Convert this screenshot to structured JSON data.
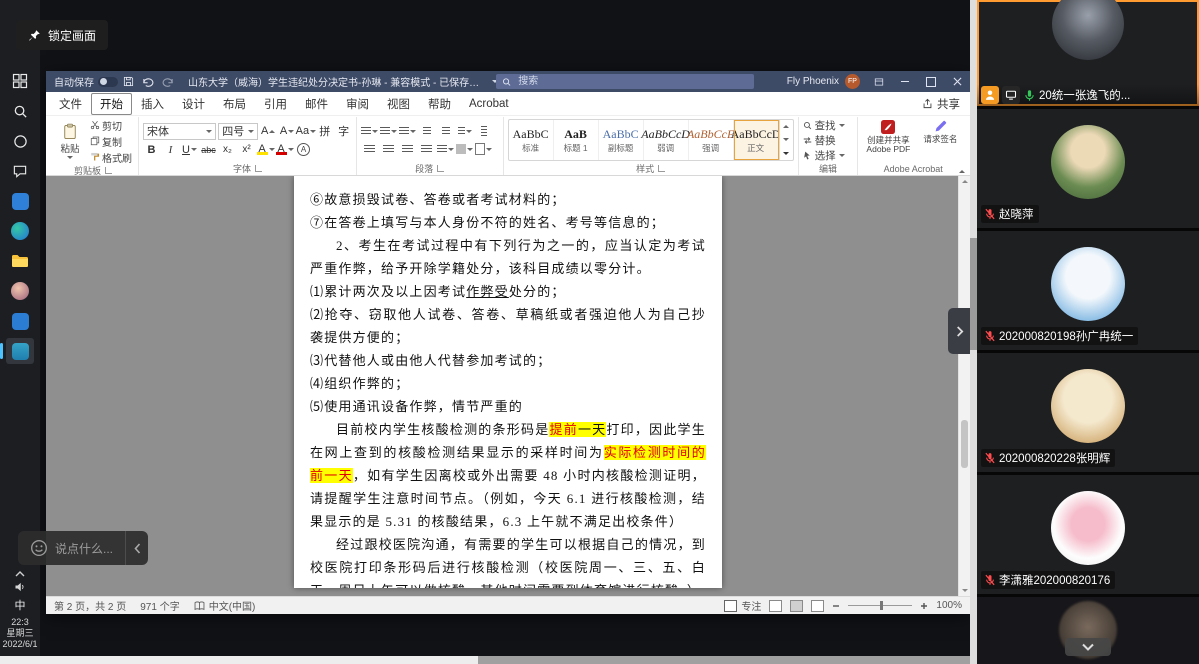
{
  "colors": {
    "highlight_yellow": "#ffff00",
    "warning_text_red": "#e00000",
    "mic_muted_red": "#ff4d4f",
    "mic_on_green": "#34c759",
    "speaking_border_orange": "#ff9b30",
    "word_titlebar_blue": "#3e4b66",
    "taskbar_accent_blue": "#4cc2ff"
  },
  "meeting": {
    "lock_button_label": "锁定画面",
    "chat_placeholder": "说点什么...",
    "participants": [
      {
        "name": "20统一张逸飞的...",
        "mic": "on",
        "role": "presenter"
      },
      {
        "name": "赵晓萍",
        "mic": "muted"
      },
      {
        "name": "202000820198孙广冉统一",
        "mic": "muted"
      },
      {
        "name": "202000820228张明辉",
        "mic": "muted"
      },
      {
        "name": "李潇雅202000820176",
        "mic": "muted"
      }
    ]
  },
  "desktop": {
    "ime_indicator": "中",
    "clock": {
      "time": "22:3",
      "weekday": "星期三",
      "date": "2022/6/1"
    }
  },
  "word": {
    "titlebar": {
      "autosave_label": "自动保存",
      "title": "山东大学（威海）学生违纪处分决定书-孙琳 - 兼容模式 - 已保存到此电脑",
      "search_placeholder": "搜索",
      "user_name": "Fly Phoenix",
      "user_initials": "FP"
    },
    "tabs": [
      "文件",
      "开始",
      "插入",
      "设计",
      "布局",
      "引用",
      "邮件",
      "审阅",
      "视图",
      "帮助",
      "Acrobat"
    ],
    "active_tab": "开始",
    "share_button": "共享",
    "ribbon": {
      "clipboard": {
        "group_label": "剪贴板",
        "paste": "粘贴",
        "cut": "剪切",
        "copy": "复制",
        "format_painter": "格式刷"
      },
      "font": {
        "group_label": "字体",
        "font_name": "宋体",
        "font_size": "四号",
        "grow_font": "A",
        "shrink_font": "A",
        "change_case": "Aa",
        "phonetic": "拼",
        "char_border": "字",
        "bold": "B",
        "italic": "I",
        "underline": "U",
        "strikethrough": "abc",
        "subscript": "x₂",
        "superscript": "x²",
        "text_highlight": "A",
        "font_color": "A",
        "enclose": "A"
      },
      "paragraph": {
        "group_label": "段落"
      },
      "styles": {
        "group_label": "样式",
        "items": [
          {
            "preview": "AaBbC",
            "name": "标准"
          },
          {
            "preview": "AaB",
            "name": "标题 1"
          },
          {
            "preview": "AaBbC",
            "name": "副标题"
          },
          {
            "preview": "AaBbCcD",
            "name": "弱调"
          },
          {
            "preview": "AaBbCcE",
            "name": "强调"
          },
          {
            "preview": "AaBbCcD",
            "name": "正文"
          }
        ]
      },
      "editing": {
        "group_label": "编辑",
        "find": "查找",
        "replace": "替换",
        "select": "选择"
      },
      "adobe": {
        "group_label": "Adobe Acrobat",
        "create_pdf": "创建并共享 Adobe PDF",
        "request_signatures": "请求签名"
      }
    },
    "document": {
      "paragraphs": [
        {
          "indent": 0,
          "segments": [
            {
              "t": "⑥故意损毁试卷、答卷或者考试材料的；"
            }
          ]
        },
        {
          "indent": 0,
          "segments": [
            {
              "t": "⑦在答卷上填写与本人身份不符的姓名、考号等信息的；"
            }
          ]
        },
        {
          "indent": 1,
          "segments": [
            {
              "t": "2、考生在考试过程中有下列行为之一的，应当认定为考试严重作弊，给予开除学籍处分，该科目成绩以零分计。"
            }
          ]
        },
        {
          "indent": 0,
          "segments": [
            {
              "t": "⑴累计两次及以上因考试"
            },
            {
              "t": "作弊受",
              "u": true
            },
            {
              "t": "处分的；"
            }
          ]
        },
        {
          "indent": 0,
          "segments": [
            {
              "t": "⑵抢夺、窃取他人试卷、答卷、草稿纸或者强迫他人为自己抄袭提供方便的；"
            }
          ]
        },
        {
          "indent": 0,
          "segments": [
            {
              "t": "⑶代替他人或由他人代替参加考试的；"
            }
          ]
        },
        {
          "indent": 0,
          "segments": [
            {
              "t": "⑷组织作弊的；"
            }
          ]
        },
        {
          "indent": 0,
          "segments": [
            {
              "t": "⑸使用通讯设备作弊，情节严重的"
            }
          ]
        },
        {
          "indent": 1,
          "segments": [
            {
              "t": "目前校内学生核酸检测的条形码是"
            },
            {
              "t": "提前",
              "h": true,
              "r": true
            },
            {
              "t": "一天",
              "h": true
            },
            {
              "t": "打印，因此学生在网上查到的核酸检测结果显示的采样时间为"
            },
            {
              "t": "实际检测时间的前一天",
              "h": true,
              "r": true
            },
            {
              "t": "，如有学生因离校或外出需要 48 小时内核酸检测证明，请提醒学生注意时间节点。（例如，今天 6.1 进行核酸检测，结果显示的是 5.31 的核酸结果，6.3 上午就不满足出校条件）"
            }
          ]
        },
        {
          "indent": 1,
          "segments": [
            {
              "t": "经过跟校医院沟通，有需要的学生可以根据自己的情况，到校医院打印条形码后进行核酸检测（校医院周一、三、五、白天、周日上午可以做核酸，其他时间需要到体育馆进行核酸。）"
            }
          ]
        }
      ]
    },
    "statusbar": {
      "page": "第 2 页，共 2 页",
      "words": "971 个字",
      "language": "中文(中国)",
      "focus_label": "专注",
      "zoom": "100%"
    }
  }
}
